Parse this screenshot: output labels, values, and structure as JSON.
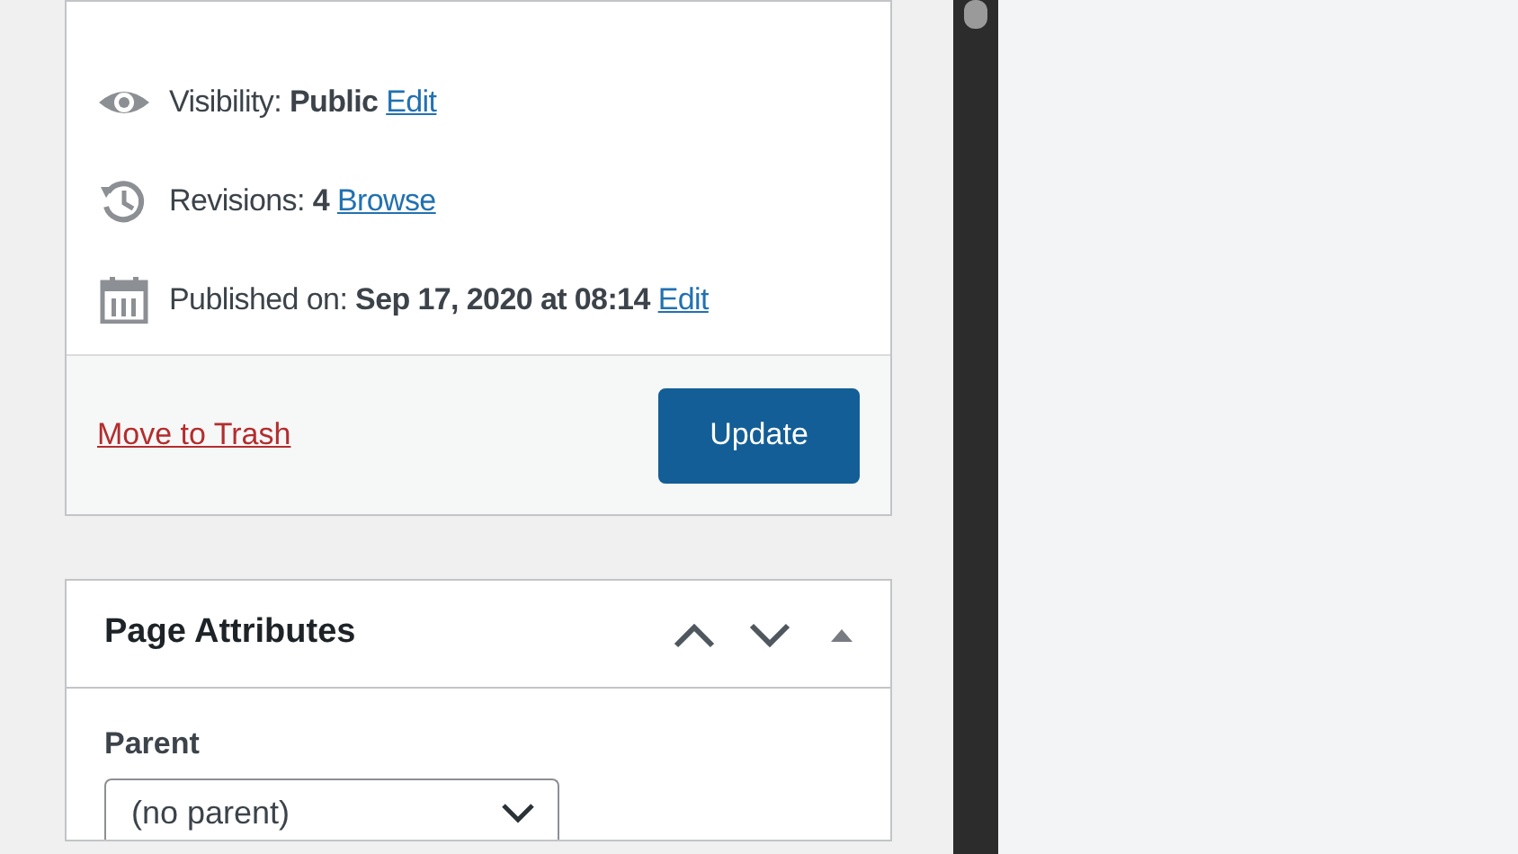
{
  "publish_box": {
    "rows": [
      {
        "kind": "visibility",
        "label": "Visibility: ",
        "value": "Public",
        "link": "Edit"
      },
      {
        "kind": "revisions",
        "label": "Revisions: ",
        "value": "4",
        "link": "Browse"
      },
      {
        "kind": "published",
        "label": "Published on: ",
        "value": "Sep 17, 2020 at 08:14",
        "link": "Edit"
      }
    ],
    "trash_link": "Move to Trash",
    "update_button": {
      "label": "Update"
    }
  },
  "page_attributes": {
    "title": "Page Attributes",
    "parent_label": "Parent",
    "parent_select": "(no parent)"
  }
}
